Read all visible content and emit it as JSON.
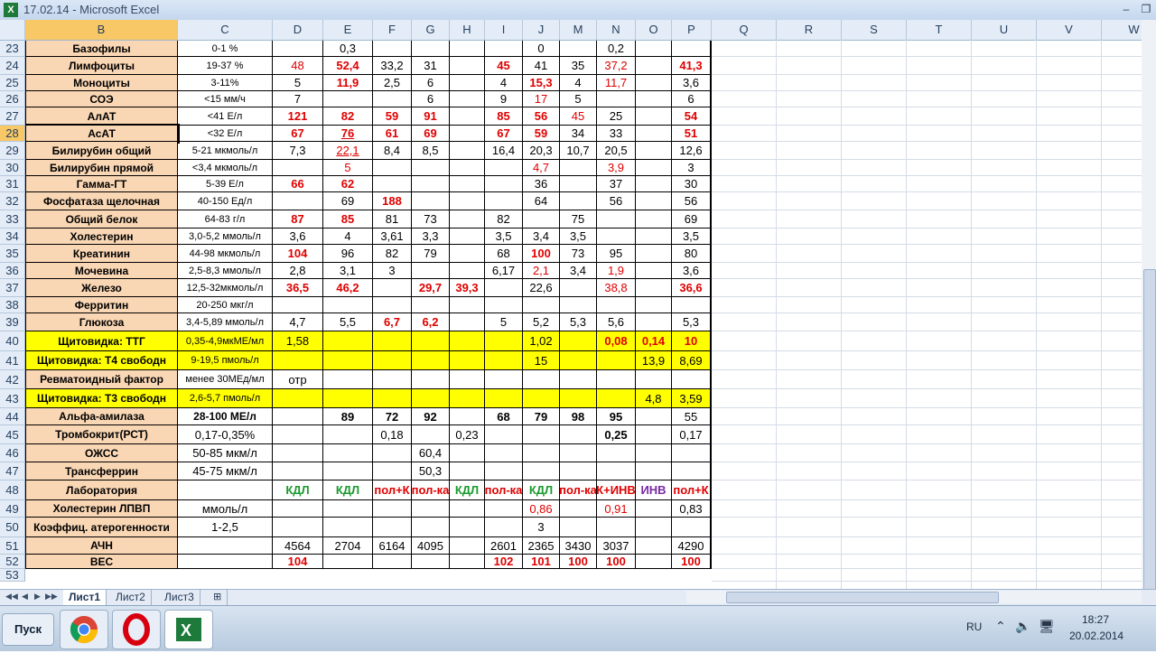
{
  "window": {
    "title": "17.02.14 - Microsoft Excel",
    "icon": "X"
  },
  "columns": [
    "B",
    "C",
    "D",
    "E",
    "F",
    "G",
    "H",
    "I",
    "J",
    "M",
    "N",
    "O",
    "P",
    "Q",
    "R",
    "S",
    "T",
    "U",
    "V",
    "W"
  ],
  "rows": [
    {
      "n": "23",
      "b": "Базофилы",
      "c": "0-1 %",
      "v": [
        "",
        "0,3",
        "",
        "",
        "",
        "",
        "0",
        "",
        "0,2",
        "",
        ""
      ]
    },
    {
      "n": "24",
      "b": "Лимфоциты",
      "c": "19-37 %",
      "v": [
        "48",
        "52,4",
        "33,2",
        "31",
        "",
        "45",
        "41",
        "35",
        "37,2",
        "",
        "41,3"
      ]
    },
    {
      "n": "25",
      "b": "Моноциты",
      "c": "3-11%",
      "v": [
        "5",
        "11,9",
        "2,5",
        "6",
        "",
        "4",
        "15,3",
        "4",
        "11,7",
        "",
        "3,6"
      ]
    },
    {
      "n": "26",
      "b": "СОЭ",
      "c": "<15 мм/ч",
      "v": [
        "7",
        "",
        "",
        "6",
        "",
        "9",
        "17",
        "5",
        "",
        "",
        "6"
      ]
    },
    {
      "n": "27",
      "b": "АлАТ",
      "c": "<41 Е/л",
      "v": [
        "121",
        "82",
        "59",
        "91",
        "",
        "85",
        "56",
        "45",
        "25",
        "",
        "54"
      ]
    },
    {
      "n": "28",
      "b": "АсАТ",
      "c": "<32 Е/л",
      "v": [
        "67",
        "76",
        "61",
        "69",
        "",
        "67",
        "59",
        "34",
        "33",
        "",
        "51"
      ]
    },
    {
      "n": "29",
      "b": "Билирубин общий",
      "c": "5-21 мкмоль/л",
      "v": [
        "7,3",
        "22,1",
        "8,4",
        "8,5",
        "",
        "16,4",
        "20,3",
        "10,7",
        "20,5",
        "",
        "12,6"
      ]
    },
    {
      "n": "30",
      "b": "Билирубин прямой",
      "c": "<3,4 мкмоль/л",
      "v": [
        "",
        "5",
        "",
        "",
        "",
        "",
        "4,7",
        "",
        "3,9",
        "",
        "3"
      ]
    },
    {
      "n": "31",
      "b": "Гамма-ГТ",
      "c": "5-39 Е/л",
      "v": [
        "66",
        "62",
        "",
        "",
        "",
        "",
        "36",
        "",
        "37",
        "",
        "30"
      ]
    },
    {
      "n": "32",
      "b": "Фосфатаза щелочная",
      "c": "40-150 Ед/л",
      "v": [
        "",
        "69",
        "188",
        "",
        "",
        "",
        "64",
        "",
        "56",
        "",
        "56"
      ]
    },
    {
      "n": "33",
      "b": "Общий белок",
      "c": "64-83 г/л",
      "v": [
        "87",
        "85",
        "81",
        "73",
        "",
        "82",
        "",
        "75",
        "",
        "",
        "69"
      ]
    },
    {
      "n": "34",
      "b": "Холестерин",
      "c": "3,0-5,2 ммоль/л",
      "v": [
        "3,6",
        "4",
        "3,61",
        "3,3",
        "",
        "3,5",
        "3,4",
        "3,5",
        "",
        "",
        "3,5"
      ]
    },
    {
      "n": "35",
      "b": "Креатинин",
      "c": "44-98 мкмоль/л",
      "v": [
        "104",
        "96",
        "82",
        "79",
        "",
        "68",
        "100",
        "73",
        "95",
        "",
        "80"
      ]
    },
    {
      "n": "36",
      "b": "Мочевина",
      "c": "2,5-8,3 ммоль/л",
      "v": [
        "2,8",
        "3,1",
        "3",
        "",
        "",
        "6,17",
        "2,1",
        "3,4",
        "1,9",
        "",
        "3,6"
      ]
    },
    {
      "n": "37",
      "b": "Железо",
      "c": "12,5-32мкмоль/л",
      "v": [
        "36,5",
        "46,2",
        "",
        "29,7",
        "39,3",
        "",
        "22,6",
        "",
        "38,8",
        "",
        "36,6"
      ]
    },
    {
      "n": "38",
      "b": "Ферритин",
      "c": "20-250 мкг/л",
      "v": [
        "",
        "",
        "",
        "",
        "",
        "",
        "",
        "",
        "",
        "",
        ""
      ]
    },
    {
      "n": "39",
      "b": "Глюкоза",
      "c": "3,4-5,89 ммоль/л",
      "v": [
        "4,7",
        "5,5",
        "6,7",
        "6,2",
        "",
        "5",
        "5,2",
        "5,3",
        "5,6",
        "",
        "5,3"
      ]
    },
    {
      "n": "40",
      "b": "Щитовидка: ТТГ",
      "c": "0,35-4,9мкМЕ/мл",
      "v": [
        "1,58",
        "",
        "",
        "",
        "",
        "",
        "1,02",
        "",
        "0,08",
        "0,14",
        "10"
      ]
    },
    {
      "n": "41",
      "b": "Щитовидка: Т4 свободн",
      "c": "9-19,5 пмоль/л",
      "v": [
        "",
        "",
        "",
        "",
        "",
        "",
        "15",
        "",
        "",
        "13,9",
        "8,69"
      ]
    },
    {
      "n": "42",
      "b": "Ревматоидный фактор",
      "c": "менее 30МЕд/мл",
      "v": [
        "отр",
        "",
        "",
        "",
        "",
        "",
        "",
        "",
        "",
        "",
        ""
      ]
    },
    {
      "n": "43",
      "b": "Щитовидка: Т3 свободн",
      "c": "2,6-5,7 пмоль/л",
      "v": [
        "",
        "",
        "",
        "",
        "",
        "",
        "",
        "",
        "",
        "4,8",
        "3,59"
      ]
    },
    {
      "n": "44",
      "b": "Альфа-амилаза",
      "c": "28-100 МЕ/л",
      "v": [
        "",
        "89",
        "72",
        "92",
        "",
        "68",
        "79",
        "98",
        "95",
        "",
        "55"
      ]
    },
    {
      "n": "45",
      "b": "Тромбокрит(РСТ)",
      "c": "0,17-0,35%",
      "v": [
        "",
        "",
        "0,18",
        "",
        "0,23",
        "",
        "",
        "",
        "0,25",
        "",
        "0,17"
      ]
    },
    {
      "n": "46",
      "b": "ОЖСС",
      "c": "50-85 мкм/л",
      "v": [
        "",
        "",
        "",
        "60,4",
        "",
        "",
        "",
        "",
        "",
        "",
        ""
      ]
    },
    {
      "n": "47",
      "b": "Трансферрин",
      "c": "45-75 мкм/л",
      "v": [
        "",
        "",
        "",
        "50,3",
        "",
        "",
        "",
        "",
        "",
        "",
        ""
      ]
    },
    {
      "n": "48",
      "b": "Лаборатория",
      "c": "",
      "v": [
        "КДЛ",
        "КДЛ",
        "пол+К",
        "пол-ка",
        "КДЛ",
        "пол-ка",
        "КДЛ",
        "пол-ка",
        "К+ИНВ",
        "ИНВ",
        "пол+К"
      ]
    },
    {
      "n": "49",
      "b": "Холестерин ЛПВП",
      "c": "ммоль/л",
      "v": [
        "",
        "",
        "",
        "",
        "",
        "",
        "0,86",
        "",
        "0,91",
        "",
        "0,83"
      ]
    },
    {
      "n": "50",
      "b": "Коэффиц. атерогенности",
      "c": "1-2,5",
      "v": [
        "",
        "",
        "",
        "",
        "",
        "",
        "3",
        "",
        "",
        "",
        ""
      ]
    },
    {
      "n": "51",
      "b": "АЧН",
      "c": "",
      "v": [
        "4564",
        "2704",
        "6164",
        "4095",
        "",
        "2601",
        "2365",
        "3430",
        "3037",
        "",
        "4290"
      ]
    },
    {
      "n": "52",
      "b": "ВЕС",
      "c": "",
      "v": [
        "104",
        "",
        "",
        "",
        "",
        "102",
        "101",
        "100",
        "100",
        "",
        "100"
      ]
    },
    {
      "n": "53",
      "b": "",
      "c": "",
      "v": [
        "",
        "",
        "",
        "",
        "",
        "",
        "",
        "",
        "",
        "",
        ""
      ]
    }
  ],
  "sheet_tabs": [
    "Лист1",
    "Лист2",
    "Лист3"
  ],
  "taskbar": {
    "start_label": "Пуск",
    "lang": "RU",
    "time": "18:27",
    "date": "20.02.2014"
  }
}
